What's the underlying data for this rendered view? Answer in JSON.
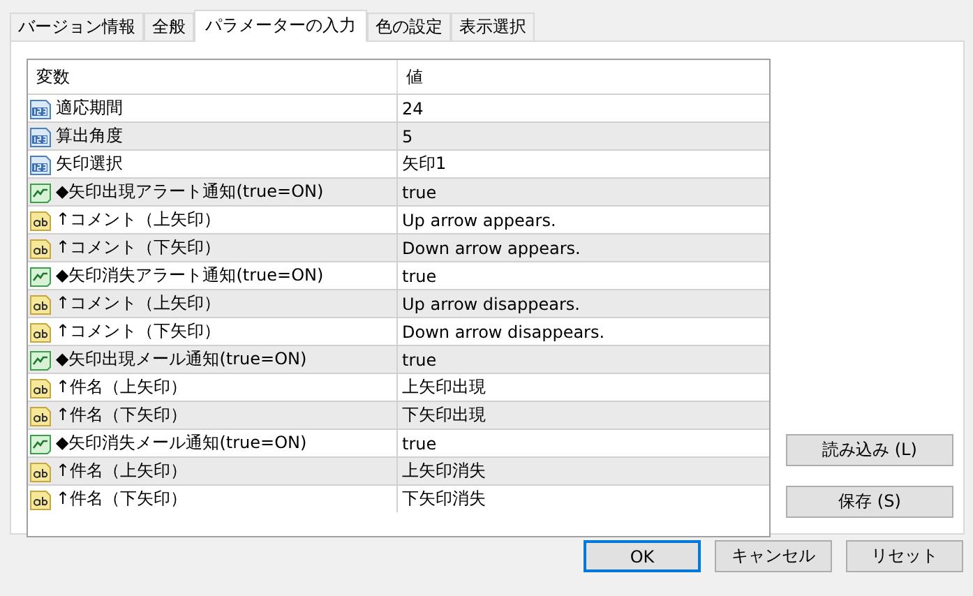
{
  "tabs": [
    {
      "label": "バージョン情報",
      "selected": false
    },
    {
      "label": "全般",
      "selected": false
    },
    {
      "label": "パラメーターの入力",
      "selected": true
    },
    {
      "label": "色の設定",
      "selected": false
    },
    {
      "label": "表示選択",
      "selected": false
    }
  ],
  "table": {
    "columns": [
      "変数",
      "値"
    ],
    "rows": [
      {
        "kind": "int",
        "name": "適応期間",
        "value": "24"
      },
      {
        "kind": "int",
        "name": "算出角度",
        "value": "5"
      },
      {
        "kind": "int",
        "name": "矢印選択",
        "value": "矢印1"
      },
      {
        "kind": "bool",
        "name": "◆矢印出現アラート通知(true=ON)",
        "value": "true"
      },
      {
        "kind": "string",
        "name": "↑コメント（上矢印）",
        "value": "Up arrow appears."
      },
      {
        "kind": "string",
        "name": "↑コメント（下矢印）",
        "value": "Down arrow appears."
      },
      {
        "kind": "bool",
        "name": "◆矢印消失アラート通知(true=ON)",
        "value": "true"
      },
      {
        "kind": "string",
        "name": "↑コメント（上矢印）",
        "value": "Up arrow disappears."
      },
      {
        "kind": "string",
        "name": "↑コメント（下矢印）",
        "value": "Down arrow disappears."
      },
      {
        "kind": "bool",
        "name": "◆矢印出現メール通知(true=ON)",
        "value": "true"
      },
      {
        "kind": "string",
        "name": "↑件名（上矢印）",
        "value": "上矢印出現"
      },
      {
        "kind": "string",
        "name": "↑件名（下矢印）",
        "value": "下矢印出現"
      },
      {
        "kind": "bool",
        "name": "◆矢印消失メール通知(true=ON)",
        "value": "true"
      },
      {
        "kind": "string",
        "name": "↑件名（上矢印）",
        "value": "上矢印消失"
      },
      {
        "kind": "string",
        "name": "↑件名（下矢印）",
        "value": "下矢印消失"
      }
    ]
  },
  "side_buttons": [
    "読み込み (L)",
    "保存 (S)"
  ],
  "buttons": [
    {
      "label": "OK",
      "default": true
    },
    {
      "label": "キャンセル",
      "default": false
    },
    {
      "label": "リセット",
      "default": false
    }
  ]
}
